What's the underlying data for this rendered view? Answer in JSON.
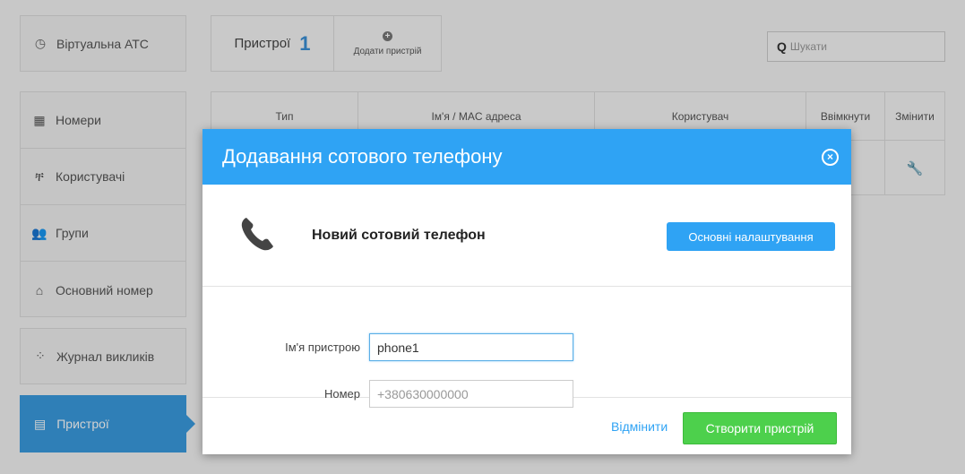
{
  "sidebar": {
    "top": {
      "label": "Віртуальна АТС",
      "icon": "speedometer-icon"
    },
    "items": [
      {
        "label": "Номери",
        "icon": "grid-icon"
      },
      {
        "label": "Користувачі",
        "icon": "users-tree-icon"
      },
      {
        "label": "Групи",
        "icon": "group-icon"
      },
      {
        "label": "Основний номер",
        "icon": "home-icon"
      }
    ],
    "call_log": {
      "label": "Журнал викликів",
      "icon": "network-icon"
    },
    "active": {
      "label": "Пристрої",
      "icon": "devices-icon"
    }
  },
  "devices": {
    "title": "Пристрої",
    "count": "1",
    "add_label": "Додати пристрій"
  },
  "search": {
    "placeholder": "Шукати"
  },
  "table": {
    "columns": [
      "Тип",
      "Ім'я / MAC адреса",
      "Користувач",
      "Ввімкнути",
      "Змінити"
    ]
  },
  "modal": {
    "title": "Додавання сотового телефону",
    "info_title": "Новий сотовий телефон",
    "settings_button": "Основні налаштування",
    "fields": {
      "device_name_label": "Ім'я пристрою",
      "device_name_value": "phone1",
      "number_label": "Номер",
      "number_placeholder": "+380630000000"
    },
    "cancel": "Відмінити",
    "create": "Створити пристрій"
  },
  "colors": {
    "accent": "#2fa3f4",
    "success": "#4dd04c",
    "active_nav": "#3a9be0"
  }
}
